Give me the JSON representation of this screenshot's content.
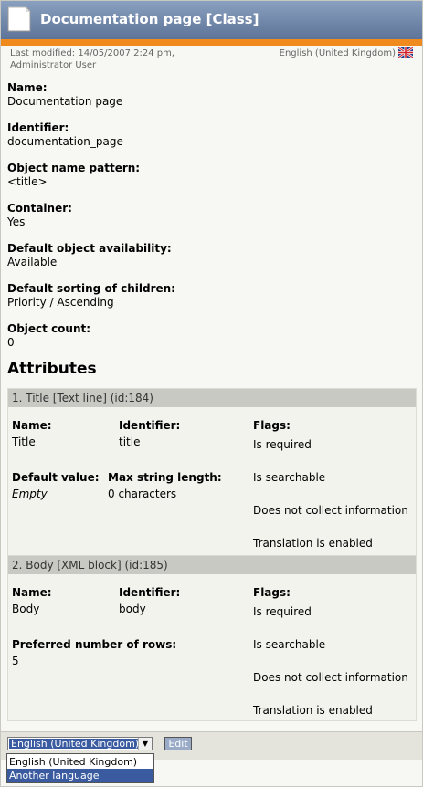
{
  "header": {
    "title": "Documentation page [Class]",
    "icon": "class-document-icon"
  },
  "meta": {
    "modified_line1": "Last modified: 14/05/2007 2:24 pm,",
    "modified_line2": "Administrator User",
    "language": "English (United Kingdom)",
    "flag_icon": "uk-flag-icon"
  },
  "properties": [
    {
      "label": "Name:",
      "value": "Documentation page"
    },
    {
      "label": "Identifier:",
      "value": "documentation_page"
    },
    {
      "label": "Object name pattern:",
      "value": "<title>"
    },
    {
      "label": "Container:",
      "value": "Yes"
    },
    {
      "label": "Default object availability:",
      "value": "Available"
    },
    {
      "label": "Default sorting of children:",
      "value": "Priority / Ascending"
    },
    {
      "label": "Object count:",
      "value": "0"
    }
  ],
  "attributes_heading": "Attributes",
  "attributes": [
    {
      "title": "1. Title [Text line] (id:184)",
      "name_label": "Name:",
      "name": "Title",
      "identifier_label": "Identifier:",
      "identifier": "title",
      "flags_label": "Flags:",
      "extra1_label": "Default value:",
      "extra1_value": "Empty",
      "extra2_label": "Max string length:",
      "extra2_value": "0 characters",
      "flags": [
        "Is required",
        "Is searchable",
        "Does not collect information",
        "Translation is enabled"
      ]
    },
    {
      "title": "2. Body [XML block] (id:185)",
      "name_label": "Name:",
      "name": "Body",
      "identifier_label": "Identifier:",
      "identifier": "body",
      "flags_label": "Flags:",
      "extra1_label": "Preferred number of rows:",
      "extra1_value": "5",
      "flags": [
        "Is required",
        "Is searchable",
        "Does not collect information",
        "Translation is enabled"
      ]
    }
  ],
  "bottom": {
    "language_selected": "English (United Kingdom)",
    "edit_label": "Edit",
    "dropdown_options": [
      "English (United Kingdom)",
      "Another language"
    ],
    "highlighted_option": "Another language"
  },
  "colors": {
    "header_bg": "#6f84a8",
    "accent_orange": "#f08a1c",
    "select_highlight": "#3a5ba0"
  }
}
